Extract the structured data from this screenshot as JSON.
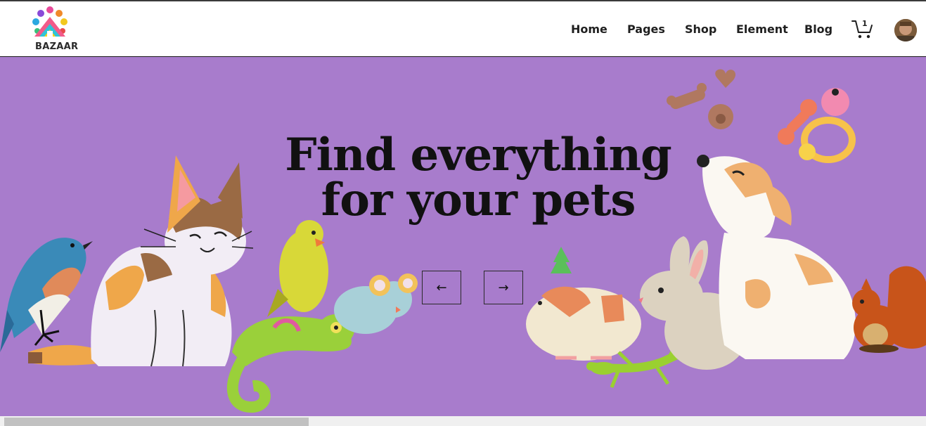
{
  "brand": {
    "logo_text": "BAZAAR"
  },
  "nav": {
    "items": [
      {
        "label": "Home"
      },
      {
        "label": "Pages"
      },
      {
        "label": "Shop"
      },
      {
        "label": "Element"
      },
      {
        "label": "Blog"
      }
    ],
    "cart_count": "1"
  },
  "hero": {
    "headline_line1": "Find everything",
    "headline_line2": "for your pets",
    "background_color": "#a87ccc",
    "prev_icon": "arrow-left-icon",
    "next_icon": "arrow-right-icon",
    "prev_symbol": "←",
    "next_symbol": "→"
  }
}
